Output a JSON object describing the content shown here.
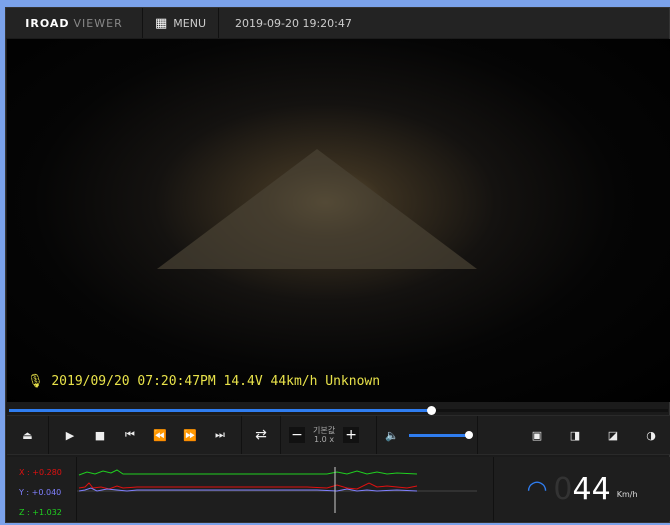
{
  "header": {
    "logo_bold": "IROAD",
    "logo_light": "VIEWER",
    "menu_label": "MENU",
    "datetime": "2019-09-20 19:20:47"
  },
  "video": {
    "overlay": "2019/09/20 07:20:47PM 14.4V 44km/h Unknown",
    "progress_percent": 64
  },
  "controls": {
    "speed_label": "기본값",
    "speed_value": "1.0 x",
    "volume_percent": 100,
    "icons": [
      "eject-icon",
      "play-icon",
      "stop-icon",
      "skip-start-icon",
      "rewind-icon",
      "fast-forward-icon",
      "skip-end-icon",
      "repeat-icon",
      "minus-icon",
      "plus-icon",
      "volume-icon",
      "full-view-icon",
      "split-view-icon",
      "pip-view-icon",
      "contrast-icon"
    ]
  },
  "gsensor": {
    "x": "X : +0.280",
    "y": "Y : +0.040",
    "z": "Z : +1.032",
    "colors": {
      "x": "#e01010",
      "y": "#8080ff",
      "z": "#20d020"
    }
  },
  "speedometer": {
    "leading": "0",
    "value": "44",
    "unit": "Km/h"
  },
  "colors": {
    "accent": "#2f7df0",
    "overlay_text": "#e8e24a"
  }
}
